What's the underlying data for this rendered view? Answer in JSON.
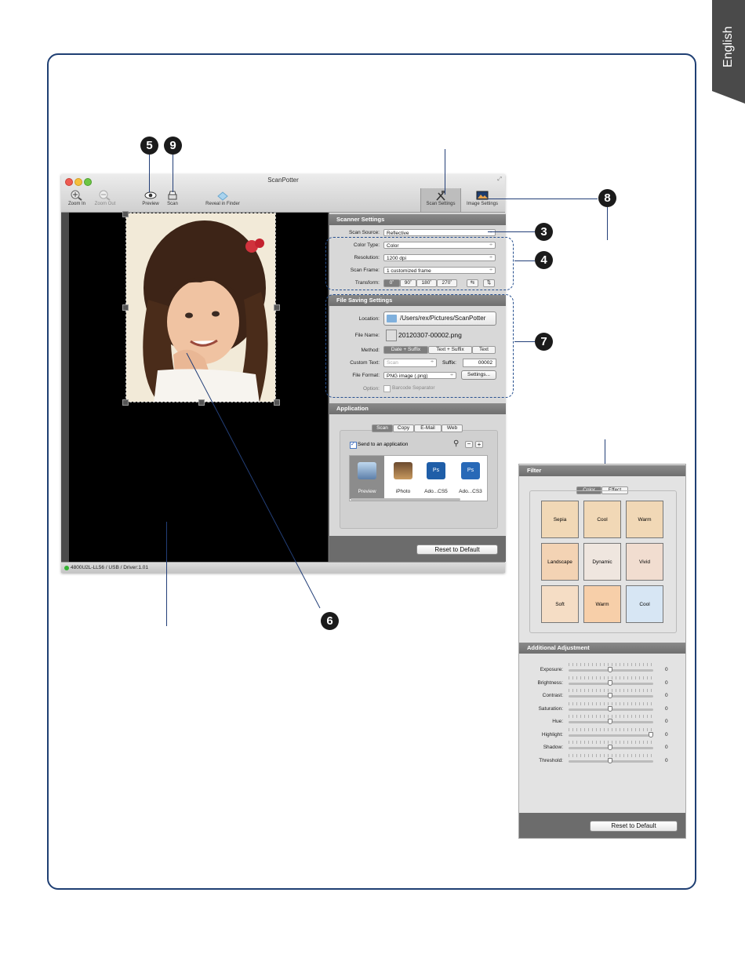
{
  "language_tab": "English",
  "window": {
    "title": "ScanPotter",
    "toolbar": {
      "zoom_in": "Zoom In",
      "zoom_out": "Zoom Out",
      "preview": "Preview",
      "scan": "Scan",
      "reveal": "Reveal in Finder",
      "scan_settings": "Scan Settings",
      "image_settings": "Image Settings"
    },
    "scanner_settings": {
      "heading": "Scanner Settings",
      "scan_source_label": "Scan Source:",
      "scan_source_value": "Reflective",
      "color_type_label": "Color Type:",
      "color_type_value": "Color",
      "resolution_label": "Resolution:",
      "resolution_value": "1200 dpi",
      "scan_frame_label": "Scan Frame:",
      "scan_frame_value": "1 customized frame",
      "transform_label": "Transform:",
      "transform_options": [
        "0˚",
        "90˚",
        "180˚",
        "270˚"
      ]
    },
    "file_saving": {
      "heading": "File Saving Settings",
      "location_label": "Location:",
      "location_value": "/Users/rex/Pictures/ScanPotter",
      "file_name_label": "File Name:",
      "file_name_value": "20120307-00002.png",
      "method_label": "Method:",
      "method_options": [
        "Date + Suffix",
        "Text + Suffix",
        "Text"
      ],
      "custom_text_label": "Custom Text:",
      "custom_text_placeholder": "Scan",
      "suffix_label": "Suffix:",
      "suffix_value": "00002",
      "file_format_label": "File Format:",
      "file_format_value": "PNG image (.png)",
      "settings_button": "Settings...",
      "option_label": "Option:",
      "barcode_label": "Barcode Separator"
    },
    "application": {
      "heading": "Application",
      "tabs": [
        "Scan",
        "Copy",
        "E-Mail",
        "Web"
      ],
      "send_to_app": "Send to an application",
      "apps": [
        "Preview",
        "iPhoto",
        "Ado...CS5",
        "Ado...CS3"
      ],
      "reset_button": "Reset to Default"
    },
    "status": "4800U2L-LL56 / USB / Driver:1.01"
  },
  "filter_panel": {
    "heading": "Filter",
    "tabs": [
      "Color",
      "Effect"
    ],
    "thumbs": [
      "Sepia",
      "Cool",
      "Warm",
      "Landscape",
      "Dynamic",
      "Vivid",
      "Soft",
      "Warm",
      "Cool"
    ],
    "additional_heading": "Additional Adjustment",
    "adjustments": [
      {
        "label": "Exposure:",
        "value": "0",
        "level": 0.5
      },
      {
        "label": "Brightness:",
        "value": "0",
        "level": 0.5
      },
      {
        "label": "Contrast:",
        "value": "0",
        "level": 0.5
      },
      {
        "label": "Saturation:",
        "value": "0",
        "level": 0.5
      },
      {
        "label": "Hue:",
        "value": "0",
        "level": 0.5
      },
      {
        "label": "Highlight:",
        "value": "0",
        "level": 1.0
      },
      {
        "label": "Shadow:",
        "value": "0",
        "level": 0.5
      },
      {
        "label": "Threshold:",
        "value": "0",
        "level": 0.5
      }
    ],
    "reset_button": "Reset to Default"
  },
  "callouts": [
    "5",
    "9",
    "8",
    "3",
    "4",
    "7",
    "6"
  ]
}
